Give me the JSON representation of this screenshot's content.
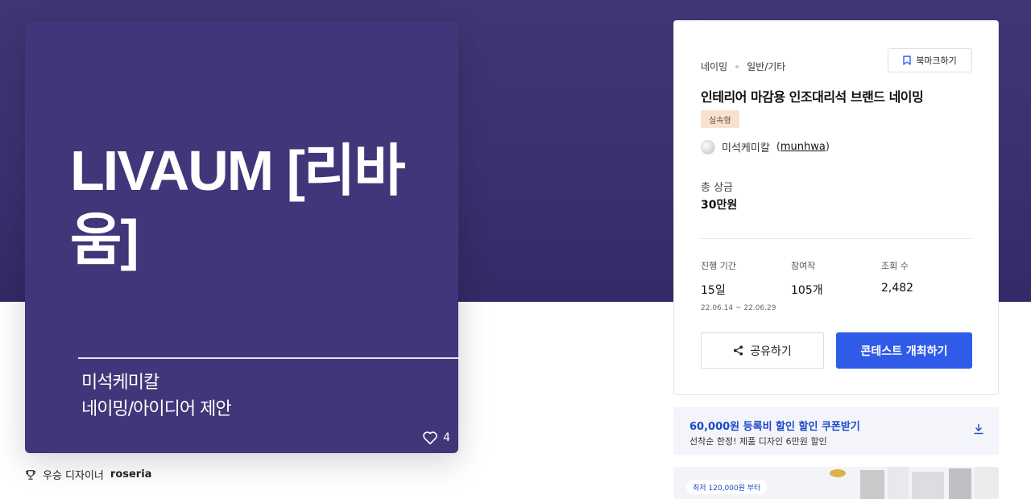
{
  "card": {
    "title": "LIVAUM [리바움]",
    "client": "미석케미칼",
    "category": "네이밍/아이디어 제안",
    "likes": "4"
  },
  "winner": {
    "label": "우승 디자이너",
    "name": "roseria"
  },
  "panel": {
    "crumb1": "네이밍",
    "crumb2": "일반/기타",
    "bookmark_label": "북마크하기",
    "title": "인테리어 마감용 인조대리석 브랜드 네이밍",
    "badge": "실속형",
    "host_name": "미석케미칼",
    "host_id": "munhwa",
    "prize_label": "총 상금",
    "prize_value": "30만원",
    "stats": [
      {
        "label": "진행 기간",
        "value": "15일",
        "sub": "22.06.14 ~ 22.06.29"
      },
      {
        "label": "참여작",
        "value": "105개"
      },
      {
        "label": "조회 수",
        "value": "2,482"
      }
    ],
    "share_label": "공유하기",
    "host_label": "콘테스트 개최하기"
  },
  "coupon": {
    "title": "60,000원 등록비 할인 할인 쿠폰받기",
    "sub": "선착순 한정! 제품 디자인 6만원 할인"
  },
  "promo": {
    "pill": "최저 120,000원 부터"
  },
  "colors": {
    "hero": "#403676",
    "card": "#413679",
    "primary": "#2f5be8",
    "coupon_text": "#1f48c7"
  }
}
